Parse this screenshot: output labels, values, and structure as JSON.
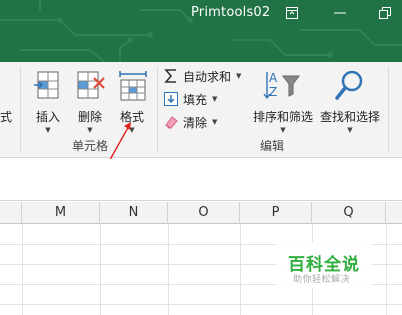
{
  "window": {
    "title": "Primtools02"
  },
  "ribbon": {
    "cells_group": {
      "label": "单元格",
      "partial_label": "式",
      "insert_label": "插入",
      "delete_label": "删除",
      "format_label": "格式"
    },
    "editing_group": {
      "label": "编辑",
      "autosum_label": "自动求和",
      "fill_label": "填充",
      "clear_label": "清除",
      "sort_filter_label": "排序和筛选",
      "find_select_label": "查找和选择"
    }
  },
  "columns": [
    "M",
    "N",
    "O",
    "P",
    "Q"
  ],
  "watermark": {
    "main": "百科全说",
    "sub": "助你轻松解决"
  },
  "colors": {
    "title_bar": "#217346",
    "ribbon_bg": "#f3f3f3",
    "annotation_arrow": "#e02020",
    "watermark_green": "#2fae3e"
  }
}
